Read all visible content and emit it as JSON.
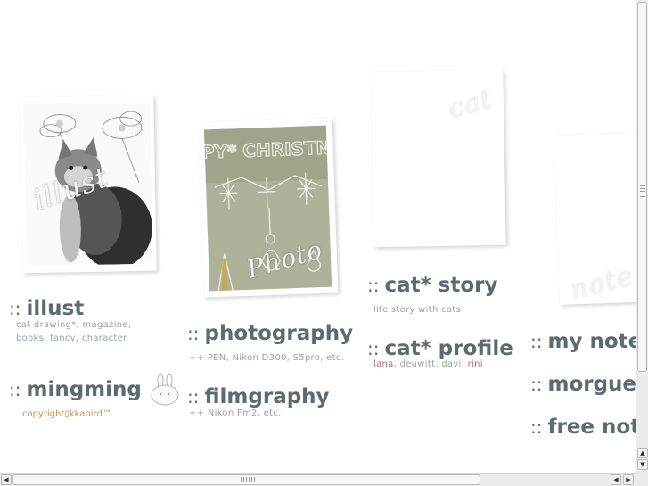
{
  "photos": {
    "illust": {
      "watermark": "illust",
      "icon": "cat-photo"
    },
    "photo": {
      "watermark": "Photo",
      "icon": "christmas-window-photo"
    },
    "cat": {
      "watermark": "cat",
      "icon": "blank-photo"
    },
    "note": {
      "watermark": "note",
      "icon": "blank-photo"
    }
  },
  "nav": {
    "colons": "::",
    "illust": {
      "title": "illust",
      "desc_line1": "cat drawing*, magazine,",
      "desc_line2": "books, fancy, character"
    },
    "mingming": {
      "title": "mingming",
      "copyright": "copyright▯kkabird™",
      "icon": "bunny-icon"
    },
    "photography": {
      "title": "photography",
      "desc": "++ PEN, Nikon D300, S5pro, etc."
    },
    "filmgraphy": {
      "title": "filmgraphy",
      "desc": "++ Nikon Fm2, etc."
    },
    "cat_story": {
      "title": "cat* story",
      "desc": "life story with cats"
    },
    "cat_profile": {
      "title": "cat* profile",
      "names": [
        "lana,",
        "deuwitt,",
        "davi,",
        "rini"
      ]
    },
    "my_note": {
      "title": "my note"
    },
    "morgue": {
      "title": "morgue"
    },
    "free_note": {
      "title": "free note"
    }
  },
  "colors": {
    "heading": "#5a6b72",
    "sub": "#9aa3a6",
    "highlight": "#c8687a",
    "copyright": "#d19051"
  },
  "scrollbars": {
    "up_icon": "arrow-up-icon",
    "down_icon": "arrow-down-icon",
    "left_icon": "arrow-left-icon",
    "right_icon": "arrow-right-icon"
  }
}
